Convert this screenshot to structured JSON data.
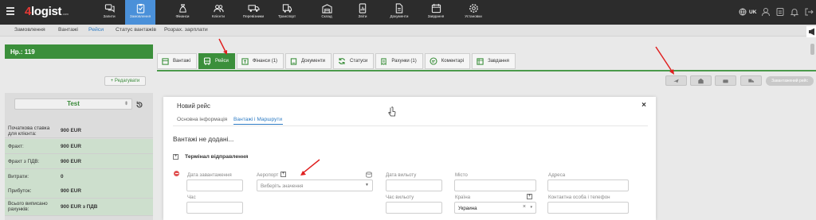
{
  "logo": {
    "four": "4",
    "rest": "logist",
    "suffix": ".com"
  },
  "nav": [
    {
      "label": "Запити",
      "icon": "chat-icon"
    },
    {
      "label": "Замовлення",
      "icon": "clipboard-icon"
    },
    {
      "label": "Фінанси",
      "icon": "money-bag-icon"
    },
    {
      "label": "Клієнти",
      "icon": "users-icon"
    },
    {
      "label": "Перевізники",
      "icon": "truck-icon"
    },
    {
      "label": "Транспорт",
      "icon": "vehicle-icon"
    },
    {
      "label": "Склад",
      "icon": "warehouse-icon"
    },
    {
      "label": "Звіти",
      "icon": "report-icon"
    },
    {
      "label": "Документи",
      "icon": "document-icon"
    },
    {
      "label": "Завдання",
      "icon": "calendar-icon"
    },
    {
      "label": "Установки",
      "icon": "gear-icon"
    }
  ],
  "language": "UK",
  "subnav": [
    "Замовлення",
    "Вантажі",
    "Рейси",
    "Статус вантажів",
    "Розрах. зарплати"
  ],
  "order": {
    "header": "Нр.: 119",
    "edit_button": "+ Редагувати"
  },
  "client": {
    "name": "Test"
  },
  "summary": [
    {
      "key": "Початкова ставка для клієнта:",
      "value": "900 EUR"
    },
    {
      "key": "Фрахт:",
      "value": "900 EUR"
    },
    {
      "key": "Фрахт з ПДВ:",
      "value": "900 EUR"
    },
    {
      "key": "Витрати:",
      "value": "0"
    },
    {
      "key": "Прибуток:",
      "value": "900 EUR"
    },
    {
      "key": "Всього виписано рахунків:",
      "value": "900 EUR з ПДВ"
    }
  ],
  "tabs": [
    {
      "label": "Вантажі",
      "icon": "box-icon"
    },
    {
      "label": "Рейси",
      "icon": "bus-icon"
    },
    {
      "label": "Фінанси (1)",
      "icon": "finance-icon"
    },
    {
      "label": "Документи",
      "icon": "document-icon"
    },
    {
      "label": "Статуси",
      "icon": "refresh-icon"
    },
    {
      "label": "Рахунки (1)",
      "icon": "invoice-icon"
    },
    {
      "label": "Коментарі",
      "icon": "comment-icon"
    },
    {
      "label": "Завдання",
      "icon": "task-icon"
    }
  ],
  "action_gray_button": "Завантажений рейс",
  "modal": {
    "title": "Новий рейс",
    "tab_basic": "Основна інформація",
    "tab_cargo": "Вантажі і Маршрути",
    "notice": "Вантажі не додані...",
    "section": "Термінал відправлення",
    "fields": {
      "load_date": "Дата завантаження",
      "time": "Час",
      "airport": "Аеропорт",
      "airport_placeholder": "Виберіть значення",
      "departure_date": "Дата вильоту",
      "departure_time": "Час вильоту",
      "city": "Місто",
      "country": "Країна",
      "country_value": "Украина",
      "address": "Адреса",
      "contact": "Контактна особа і телефон"
    }
  },
  "colors": {
    "green": "#3b8f3b",
    "blue": "#4a90d9",
    "nav_bg": "#2c2c2c",
    "arrow": "#e02020"
  }
}
